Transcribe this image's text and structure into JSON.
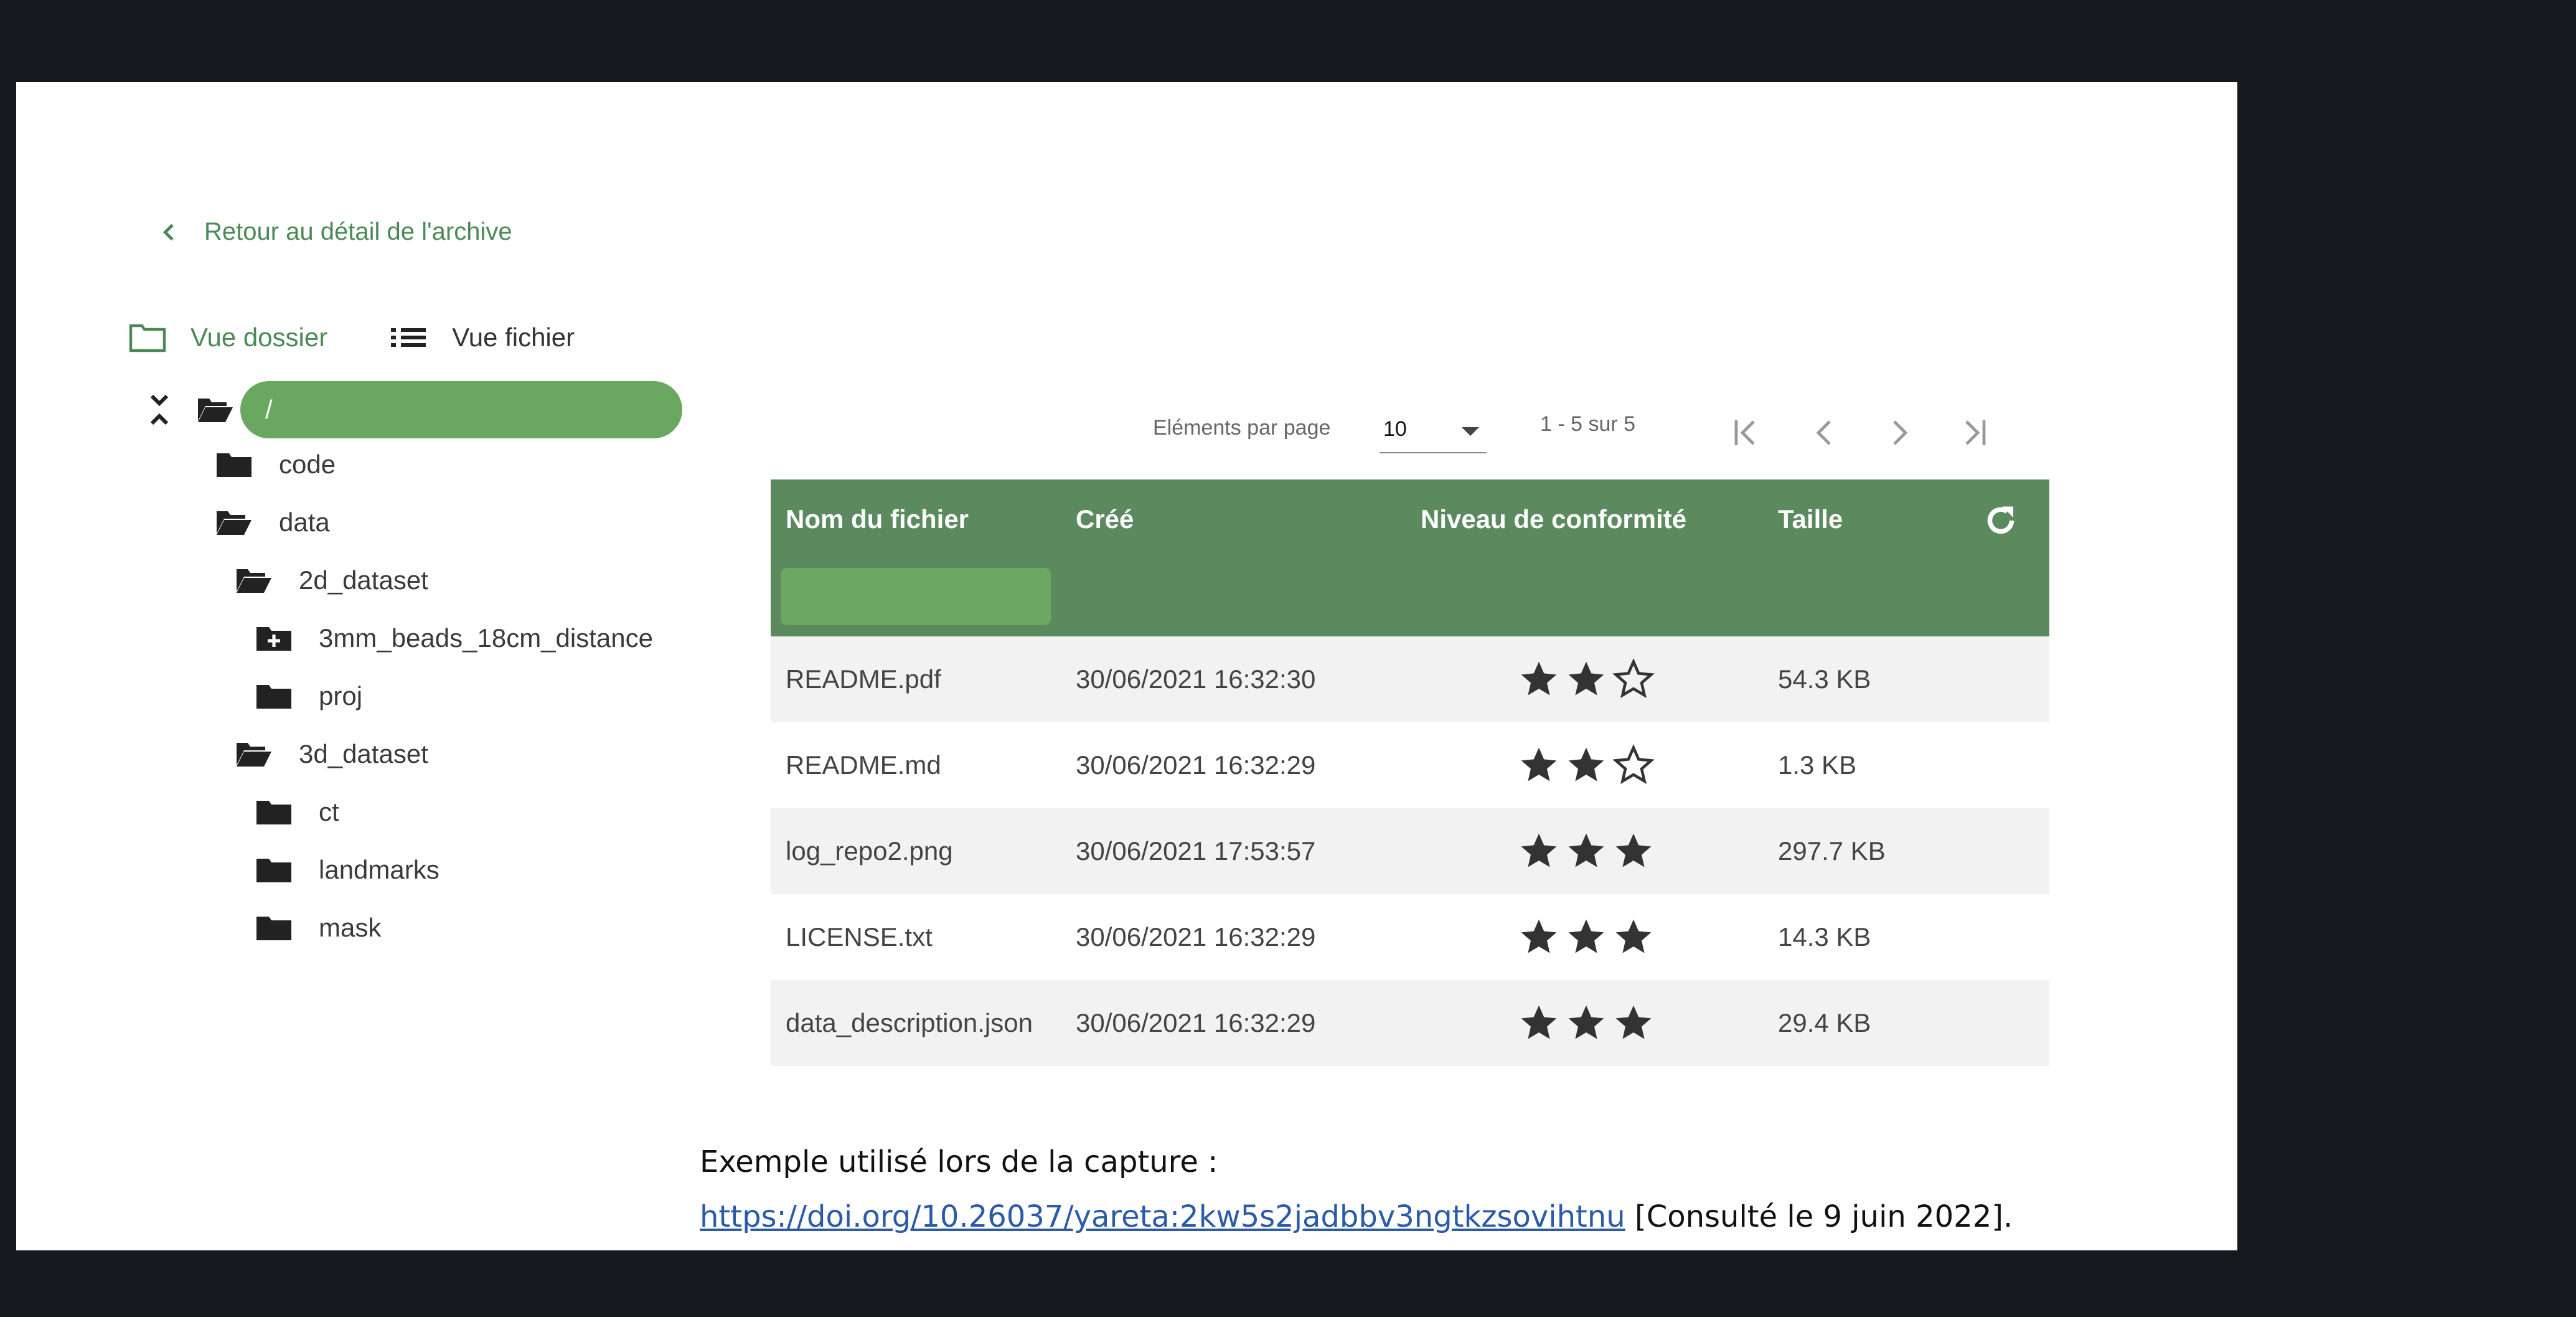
{
  "back_link": {
    "label": "Retour au détail de l'archive"
  },
  "view_toggle": {
    "folder_label": "Vue dossier",
    "file_label": "Vue fichier"
  },
  "tree": {
    "root_label": "/",
    "nodes": [
      {
        "label": "code",
        "icon": "folder-closed-icon"
      },
      {
        "label": "data",
        "icon": "folder-open-icon"
      },
      {
        "label": "2d_dataset",
        "icon": "folder-open-icon"
      },
      {
        "label": "3mm_beads_18cm_distance",
        "icon": "folder-plus-icon"
      },
      {
        "label": "proj",
        "icon": "folder-closed-icon"
      },
      {
        "label": "3d_dataset",
        "icon": "folder-open-icon"
      },
      {
        "label": "ct",
        "icon": "folder-closed-icon"
      },
      {
        "label": "landmarks",
        "icon": "folder-closed-icon"
      },
      {
        "label": "mask",
        "icon": "folder-closed-icon"
      }
    ]
  },
  "pagination": {
    "items_per_page_label": "Eléments par page",
    "items_per_page_value": "10",
    "range_label": "1 - 5 sur 5"
  },
  "table": {
    "headers": [
      "Nom du fichier",
      "Créé",
      "Niveau de conformité",
      "Taille"
    ],
    "rows": [
      {
        "name": "README.pdf",
        "created": "30/06/2021 16:32:30",
        "stars": 2,
        "size": "54.3 KB"
      },
      {
        "name": "README.md",
        "created": "30/06/2021 16:32:29",
        "stars": 2,
        "size": "1.3 KB"
      },
      {
        "name": "log_repo2.png",
        "created": "30/06/2021 17:53:57",
        "stars": 3,
        "size": "297.7 KB"
      },
      {
        "name": "LICENSE.txt",
        "created": "30/06/2021 16:32:29",
        "stars": 3,
        "size": "14.3 KB"
      },
      {
        "name": "data_description.json",
        "created": "30/06/2021 16:32:29",
        "stars": 3,
        "size": "29.4 KB"
      }
    ],
    "stars_max": 3
  },
  "caption": {
    "line1": "Exemple utilisé lors de la capture :",
    "link": "https://doi.org/10.26037/yareta:2kw5s2jadbbv3ngtkzsovihtnu",
    "suffix": " [Consulté le 9 juin 2022]."
  },
  "colors": {
    "accent": "#4a8a55",
    "header_bg": "#5b8a5f",
    "pill": "#6aa760",
    "page_bg": "#16181d"
  }
}
